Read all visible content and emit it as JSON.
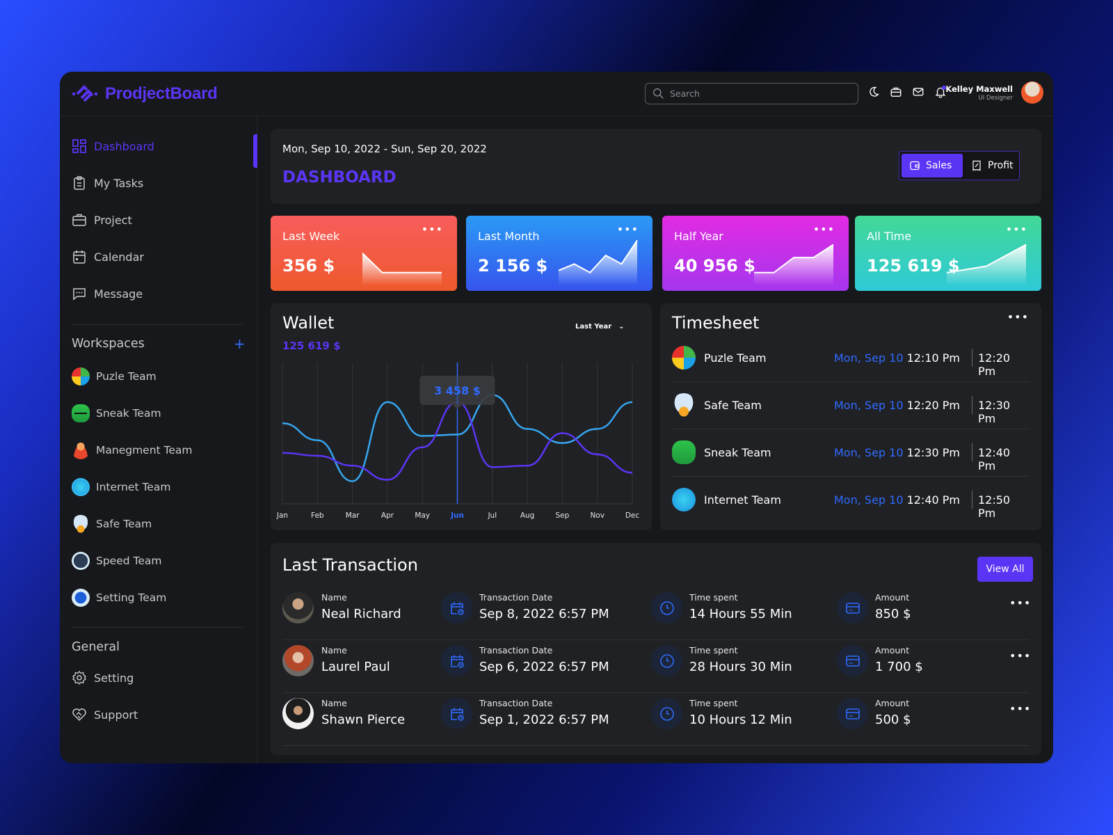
{
  "app": {
    "brand": "ProdjectBoard",
    "search_placeholder": "Search",
    "user": {
      "name": "Kelley Maxwell",
      "role": "UI Designer"
    },
    "colors": {
      "accent": "#5b35f5",
      "link_blue": "#2f6bff",
      "bg": "#17181b",
      "panel": "#202124"
    },
    "top_icons": [
      "moon-icon",
      "briefcase-icon",
      "mail-icon",
      "bell-icon"
    ]
  },
  "sidebar": {
    "nav": [
      {
        "label": "Dashboard",
        "icon": "dashboard-icon",
        "active": true
      },
      {
        "label": "My Tasks",
        "icon": "clipboard-icon"
      },
      {
        "label": "Project",
        "icon": "briefcase-icon"
      },
      {
        "label": "Calendar",
        "icon": "calendar-icon"
      },
      {
        "label": "Message",
        "icon": "message-icon"
      }
    ],
    "workspaces_title": "Workspaces",
    "workspaces": [
      {
        "label": "Puzle Team",
        "icon": "puzzle-icon"
      },
      {
        "label": "Sneak Team",
        "icon": "snake-icon"
      },
      {
        "label": "Manegment Team",
        "icon": "manager-icon"
      },
      {
        "label": "Internet Team",
        "icon": "globe-icon"
      },
      {
        "label": "Safe Team",
        "icon": "cloud-shield-icon"
      },
      {
        "label": "Speed Team",
        "icon": "speedometer-icon"
      },
      {
        "label": "Setting Team",
        "icon": "gear-wrench-icon"
      }
    ],
    "general_title": "General",
    "general": [
      {
        "label": "Setting",
        "icon": "gear-icon"
      },
      {
        "label": "Support",
        "icon": "handshake-heart-icon"
      }
    ]
  },
  "header": {
    "date_range": "Mon, Sep 10, 2022 - Sun, Sep 20, 2022",
    "title": "DASHBOARD",
    "toggle": [
      {
        "label": "Sales",
        "active": true
      },
      {
        "label": "Profit",
        "active": false
      }
    ]
  },
  "stats": [
    {
      "label": "Last Week",
      "value": "356 $",
      "trend": [
        0.55,
        0.1,
        0.1,
        0.1,
        0.1
      ]
    },
    {
      "label": "Last Month",
      "value": "2 156 $",
      "trend": [
        0.15,
        0.3,
        0.1,
        0.5,
        0.3,
        0.85
      ]
    },
    {
      "label": "Half Year",
      "value": "40 956 $",
      "trend": [
        0.1,
        0.1,
        0.45,
        0.45,
        0.75
      ]
    },
    {
      "label": "All Time",
      "value": "125 619 $",
      "trend": [
        0.1,
        0.25,
        0.75
      ]
    }
  ],
  "wallet": {
    "title": "Wallet",
    "total": "125 619 $",
    "period": "Last Year",
    "tooltip": "3 458 $",
    "highlight_month": "Jun"
  },
  "chart_data": {
    "type": "line",
    "title": "Wallet",
    "categories": [
      "Jan",
      "Feb",
      "Mar",
      "Apr",
      "May",
      "Jun",
      "Jul",
      "Aug",
      "Sep",
      "Nov",
      "Dec"
    ],
    "series": [
      {
        "name": "Series A (light blue)",
        "color": "#35a6f0",
        "values": [
          57,
          45,
          16,
          72,
          48,
          49,
          77,
          53,
          43,
          53,
          72
        ]
      },
      {
        "name": "Series B (purple)",
        "color": "#5b35f5",
        "values": [
          36,
          34,
          27,
          17,
          40,
          72,
          26,
          27,
          50,
          35,
          22
        ]
      }
    ],
    "ylim": [
      0,
      100
    ],
    "grid": "vertical",
    "tooltip": {
      "category": "Jun",
      "label": "3 458 $"
    }
  },
  "timesheet": {
    "title": "Timesheet",
    "rows": [
      {
        "team": "Puzle Team",
        "icon": "puzzle-icon",
        "date": "Mon, Sep 10",
        "start": "12:10 Pm",
        "end": "12:20 Pm"
      },
      {
        "team": "Safe Team",
        "icon": "cloud-shield-icon",
        "date": "Mon, Sep 10",
        "start": "12:20 Pm",
        "end": "12:30 Pm"
      },
      {
        "team": "Sneak Team",
        "icon": "snake-icon",
        "date": "Mon, Sep 10",
        "start": "12:30 Pm",
        "end": "12:40 Pm"
      },
      {
        "team": "Internet Team",
        "icon": "globe-icon",
        "date": "Mon, Sep 10",
        "start": "12:40 Pm",
        "end": "12:50 Pm"
      }
    ]
  },
  "transactions": {
    "title": "Last Transaction",
    "view_all": "View All",
    "labels": {
      "name": "Name",
      "date": "Transaction Date",
      "time": "Time spent",
      "amount": "Amount"
    },
    "rows": [
      {
        "name": "Neal Richard",
        "date": "Sep 8, 2022 6:57 PM",
        "time": "14 Hours 55 Min",
        "amount": "850 $"
      },
      {
        "name": "Laurel Paul",
        "date": "Sep 6, 2022 6:57 PM",
        "time": "28 Hours 30 Min",
        "amount": "1 700 $"
      },
      {
        "name": "Shawn Pierce",
        "date": "Sep 1, 2022 6:57 PM",
        "time": "10 Hours 12 Min",
        "amount": "500 $"
      }
    ]
  }
}
